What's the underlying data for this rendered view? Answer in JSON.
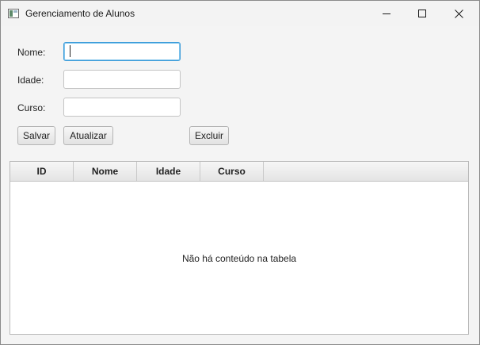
{
  "window": {
    "title": "Gerenciamento de Alunos",
    "icon": "app-window-icon",
    "controls": [
      "minimize-icon",
      "maximize-icon",
      "close-icon"
    ]
  },
  "form": {
    "nome": {
      "label": "Nome:",
      "value": "",
      "placeholder": ""
    },
    "idade": {
      "label": "Idade:",
      "value": "",
      "placeholder": ""
    },
    "curso": {
      "label": "Curso:",
      "value": "",
      "placeholder": ""
    }
  },
  "buttons": {
    "salvar": "Salvar",
    "atualizar": "Atualizar",
    "excluir": "Excluir"
  },
  "table": {
    "columns": [
      "ID",
      "Nome",
      "Idade",
      "Curso"
    ],
    "rows": [],
    "empty_message": "Não há conteúdo na tabela"
  },
  "colors": {
    "focus_border": "#3b9bd9",
    "background": "#f4f4f4"
  }
}
